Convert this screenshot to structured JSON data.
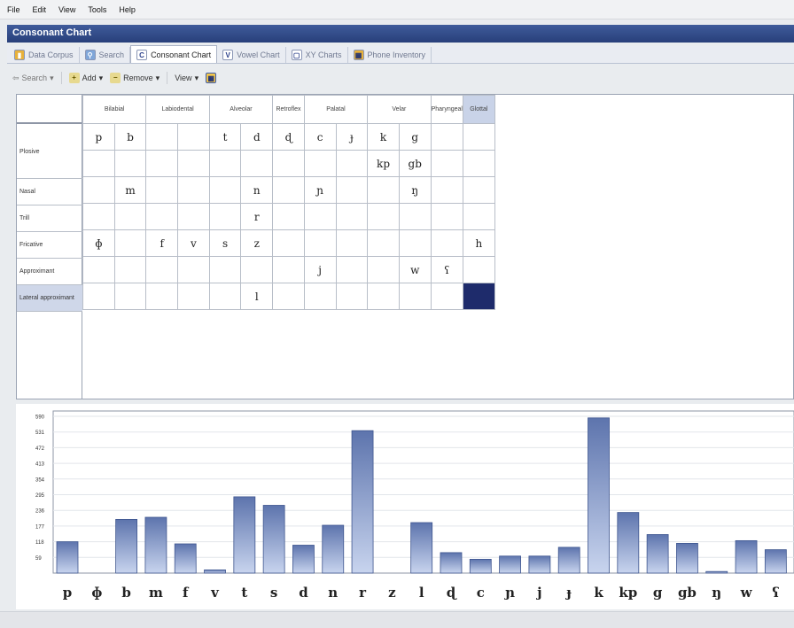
{
  "menu": [
    "File",
    "Edit",
    "View",
    "Tools",
    "Help"
  ],
  "window_title": "Consonant Chart",
  "tabs": [
    {
      "label": "Data Corpus",
      "icon": "data-corpus-icon",
      "active": false
    },
    {
      "label": "Search",
      "icon": "search-icon",
      "active": false
    },
    {
      "label": "Consonant Chart",
      "icon": "consonant-chart-icon",
      "active": true
    },
    {
      "label": "Vowel Chart",
      "icon": "vowel-chart-icon",
      "active": false
    },
    {
      "label": "XY Charts",
      "icon": "xy-charts-icon",
      "active": false
    },
    {
      "label": "Phone Inventory",
      "icon": "phone-inventory-icon",
      "active": false
    }
  ],
  "toolbar": {
    "search": "Search",
    "add": "Add",
    "remove": "Remove",
    "view": "View"
  },
  "columns": [
    {
      "label": "Bilabial",
      "span": 2
    },
    {
      "label": "Labiodental",
      "span": 2
    },
    {
      "label": "Alveolar",
      "span": 2
    },
    {
      "label": "Retroflex",
      "span": 1
    },
    {
      "label": "Palatal",
      "span": 2
    },
    {
      "label": "Velar",
      "span": 2
    },
    {
      "label": "Pharyngeal",
      "span": 1
    },
    {
      "label": "Glottal",
      "span": 1
    }
  ],
  "rows": [
    {
      "label": "Plosive",
      "cells": [
        "p",
        "b",
        "",
        "",
        "t",
        "d",
        "ɖ",
        "c",
        "ɟ",
        "k",
        "g",
        "",
        ""
      ]
    },
    {
      "label": "",
      "cells": [
        "",
        "",
        "",
        "",
        "",
        "",
        "",
        "",
        "",
        "kp",
        "gb",
        "",
        ""
      ]
    },
    {
      "label": "Nasal",
      "cells": [
        "",
        "m",
        "",
        "",
        "",
        "n",
        "",
        "ɲ",
        "",
        "",
        "ŋ",
        "",
        ""
      ]
    },
    {
      "label": "Trill",
      "cells": [
        "",
        "",
        "",
        "",
        "",
        "r",
        "",
        "",
        "",
        "",
        "",
        "",
        ""
      ]
    },
    {
      "label": "Fricative",
      "cells": [
        "ɸ",
        "",
        "f",
        "v",
        "s",
        "z",
        "",
        "",
        "",
        "",
        "",
        "",
        "h"
      ]
    },
    {
      "label": "Approximant",
      "cells": [
        "",
        "",
        "",
        "",
        "",
        "",
        "",
        "j",
        "",
        "",
        "w",
        "ʕ",
        ""
      ]
    },
    {
      "label": "Lateral approximant",
      "cells": [
        "",
        "",
        "",
        "",
        "",
        "l",
        "",
        "",
        "",
        "",
        "",
        "",
        ""
      ]
    }
  ],
  "chart_data": {
    "type": "bar",
    "categories": [
      "p",
      "ɸ",
      "b",
      "m",
      "f",
      "v",
      "t",
      "s",
      "d",
      "n",
      "r",
      "z",
      "l",
      "ɖ",
      "c",
      "ɲ",
      "j",
      "ɟ",
      "k",
      "kp",
      "g",
      "gb",
      "ŋ",
      "w",
      "ʕ"
    ],
    "values": [
      118,
      0,
      202,
      210,
      110,
      12,
      287,
      255,
      105,
      180,
      536,
      0,
      190,
      77,
      52,
      64,
      64,
      97,
      584,
      228,
      145,
      112,
      6,
      122,
      88
    ],
    "yticks": [
      59,
      118,
      177,
      236,
      295,
      354,
      413,
      472,
      531,
      590
    ],
    "ylim": [
      0,
      610
    ]
  }
}
